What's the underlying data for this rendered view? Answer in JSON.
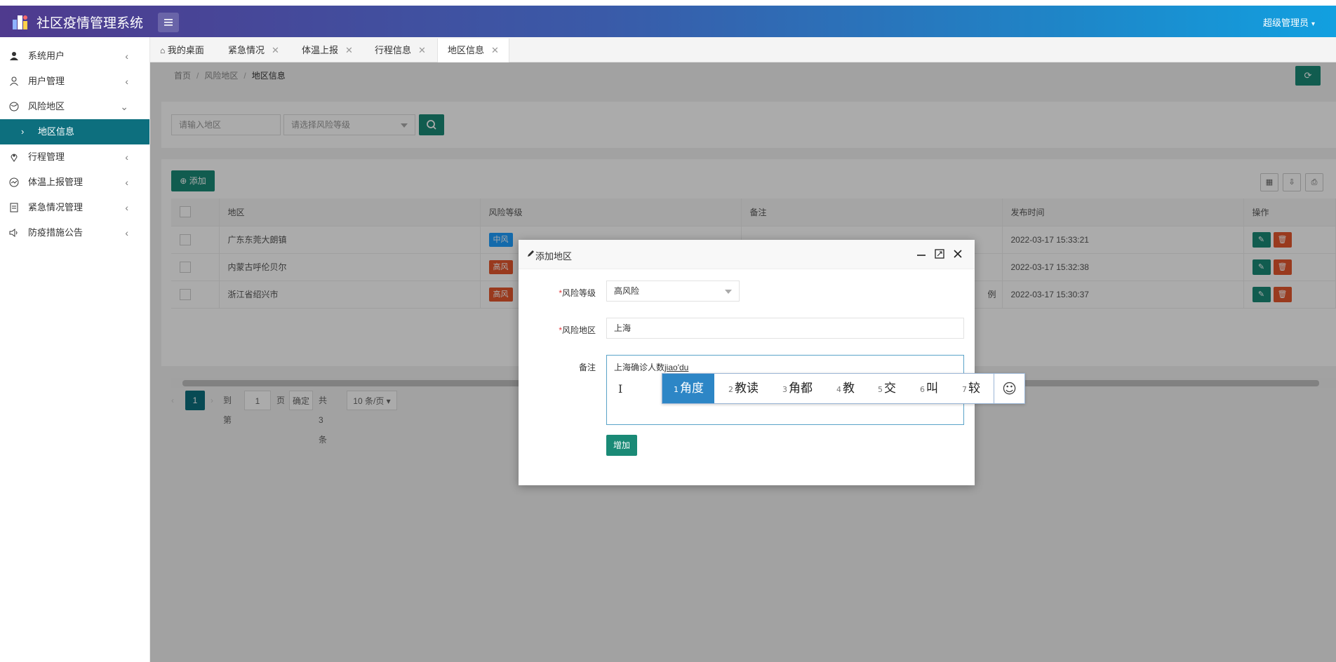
{
  "header": {
    "title": "社区疫情管理系统",
    "user": "超级管理员"
  },
  "sidebar": {
    "items": [
      {
        "label": "系统用户",
        "icon": "user-icon"
      },
      {
        "label": "用户管理",
        "icon": "user-outline-icon"
      },
      {
        "label": "风险地区",
        "icon": "globe-icon"
      },
      {
        "label": "地区信息",
        "icon": ""
      },
      {
        "label": "行程管理",
        "icon": "location-icon"
      },
      {
        "label": "体温上报管理",
        "icon": "chart-icon"
      },
      {
        "label": "紧急情况管理",
        "icon": "form-icon"
      },
      {
        "label": "防疫措施公告",
        "icon": "speaker-icon"
      }
    ]
  },
  "tabs": [
    {
      "label": "我的桌面"
    },
    {
      "label": "紧急情况"
    },
    {
      "label": "体温上报"
    },
    {
      "label": "行程信息"
    },
    {
      "label": "地区信息"
    }
  ],
  "breadcrumb": {
    "home": "首页",
    "parent": "风险地区",
    "current": "地区信息"
  },
  "search": {
    "region_placeholder": "请输入地区",
    "level_placeholder": "请选择风险等级"
  },
  "toolbar": {
    "add_label": "添加"
  },
  "table": {
    "headers": [
      "地区",
      "风险等级",
      "备注",
      "发布时间",
      "操作"
    ],
    "rows": [
      {
        "region": "广东东莞大朗镇",
        "level": "中风",
        "level_color": "#1e9fff",
        "note": "",
        "time": "2022-03-17 15:33:21"
      },
      {
        "region": "内蒙古呼伦贝尔",
        "level": "高风",
        "level_color": "#e4572e",
        "note": "",
        "time": "2022-03-17 15:32:38"
      },
      {
        "region": "浙江省绍兴市",
        "level": "高风",
        "level_color": "#e4572e",
        "note": "例",
        "time": "2022-03-17 15:30:37"
      }
    ]
  },
  "pager": {
    "current": "1",
    "goto_label": "到第",
    "goto_value": "1",
    "page_label": "页",
    "confirm_label": "确定",
    "total_label": "共 3 条",
    "page_size": "10 条/页"
  },
  "dialog": {
    "title": "添加地区",
    "level_label": "风险等级",
    "level_value": "高风险",
    "region_label": "风险地区",
    "region_value": "上海",
    "note_label": "备注",
    "note_text": "上海确诊人数",
    "note_composition": "jiao'du",
    "submit_label": "增加"
  },
  "ime": {
    "candidates": [
      {
        "num": "1",
        "text": "角度"
      },
      {
        "num": "2",
        "text": "教读"
      },
      {
        "num": "3",
        "text": "角都"
      },
      {
        "num": "4",
        "text": "教"
      },
      {
        "num": "5",
        "text": "交"
      },
      {
        "num": "6",
        "text": "叫"
      },
      {
        "num": "7",
        "text": "较"
      }
    ]
  },
  "colors": {
    "primary": "#1a8a76",
    "danger": "#e4572e",
    "active_nav": "#0d6f7e"
  }
}
